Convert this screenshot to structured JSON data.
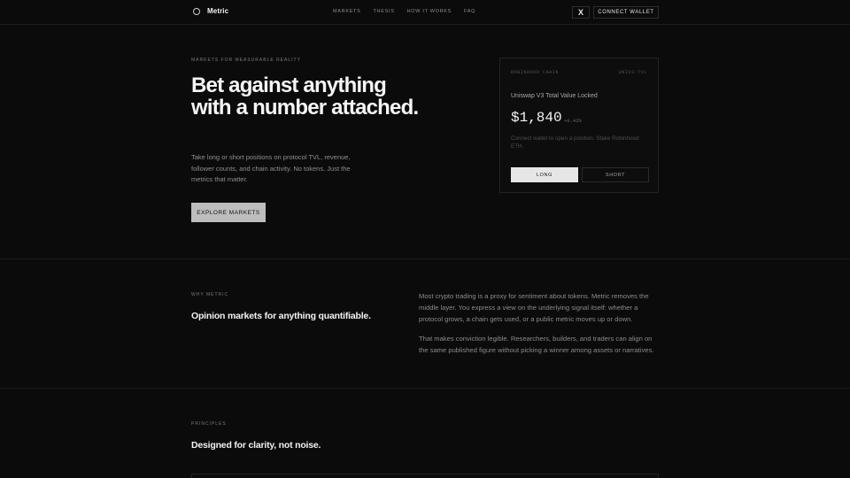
{
  "header": {
    "brand": "Metric",
    "nav": [
      "MARKETS",
      "THESIS",
      "HOW IT WORKS",
      "FAQ"
    ],
    "x_label": "X",
    "wallet_label": "CONNECT WALLET"
  },
  "hero": {
    "eyebrow": "MARKETS FOR MEASURABLE REALITY",
    "title": "Bet against anything with a number attached.",
    "description": "Take long or short positions on protocol TVL, revenue, follower counts, and chain activity. No tokens. Just the metrics that matter.",
    "cta": "EXPLORE MARKETS"
  },
  "card": {
    "chain": "ROBINHOOD CHAIN",
    "ticker": "UNIV3-TVL",
    "market": "Uniswap V3 Total Value Locked",
    "price": "$1,840",
    "change": "+0.42%",
    "note": "Connect wallet to open a position. Stake Robinhood ETH.",
    "long_label": "LONG",
    "short_label": "SHORT"
  },
  "why": {
    "eyebrow": "WHY METRIC",
    "heading": "Opinion markets for anything quantifiable.",
    "para1": "Most crypto trading is a proxy for sentiment about tokens. Metric removes the middle layer. You express a view on the underlying signal itself: whether a protocol grows, a chain gets used, or a public metric moves up or down.",
    "para2": "That makes conviction legible. Researchers, builders, and traders can align on the same published figure without picking a winner among assets or narratives."
  },
  "principles": {
    "eyebrow": "PRINCIPLES",
    "heading": "Designed for clarity, not noise."
  }
}
